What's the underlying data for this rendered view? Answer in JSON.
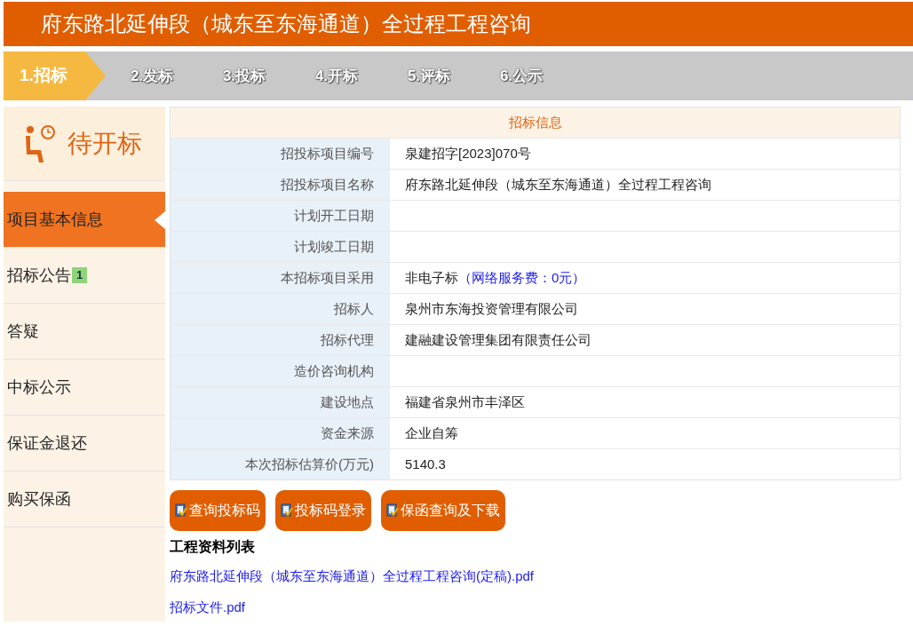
{
  "header": {
    "title": "府东路北延伸段（城东至东海通道）全过程工程咨询"
  },
  "steps": [
    {
      "label": "1.招标",
      "selected": true
    },
    {
      "label": "2.发标",
      "selected": false
    },
    {
      "label": "3.投标",
      "selected": false
    },
    {
      "label": "4.开标",
      "selected": false
    },
    {
      "label": "5.评标",
      "selected": false
    },
    {
      "label": "6.公示",
      "selected": false
    }
  ],
  "status": {
    "label": "待开标"
  },
  "sidebar": {
    "items": [
      {
        "label": "项目基本信息",
        "selected": true
      },
      {
        "label": "招标公告",
        "selected": false,
        "badge": "1"
      },
      {
        "label": "答疑",
        "selected": false
      },
      {
        "label": "中标公示",
        "selected": false
      },
      {
        "label": "保证金退还",
        "selected": false
      },
      {
        "label": "购买保函",
        "selected": false
      }
    ]
  },
  "info_table": {
    "title": "招标信息",
    "rows": [
      {
        "label": "招投标项目编号",
        "value": "泉建招字[2023]070号"
      },
      {
        "label": "招投标项目名称",
        "value": "府东路北延伸段（城东至东海通道）全过程工程咨询"
      },
      {
        "label": "计划开工日期",
        "value": ""
      },
      {
        "label": "计划竣工日期",
        "value": ""
      },
      {
        "label": "本招标项目采用",
        "value": "非电子标",
        "note": "（网络服务费：0元）"
      },
      {
        "label": "招标人",
        "value": "泉州市东海投资管理有限公司"
      },
      {
        "label": "招标代理",
        "value": "建融建设管理集团有限责任公司"
      },
      {
        "label": "造价咨询机构",
        "value": ""
      },
      {
        "label": "建设地点",
        "value": "福建省泉州市丰泽区"
      },
      {
        "label": "资金来源",
        "value": "企业自筹"
      },
      {
        "label": "本次招标估算价(万元)",
        "value": "5140.3"
      }
    ]
  },
  "buttons": [
    "查询投标码",
    "投标码登录",
    "保函查询及下载"
  ],
  "files": {
    "title": "工程资料列表",
    "items": [
      "府东路北延伸段（城东至东海通道）全过程工程咨询(定稿).pdf",
      "招标文件.pdf"
    ]
  }
}
